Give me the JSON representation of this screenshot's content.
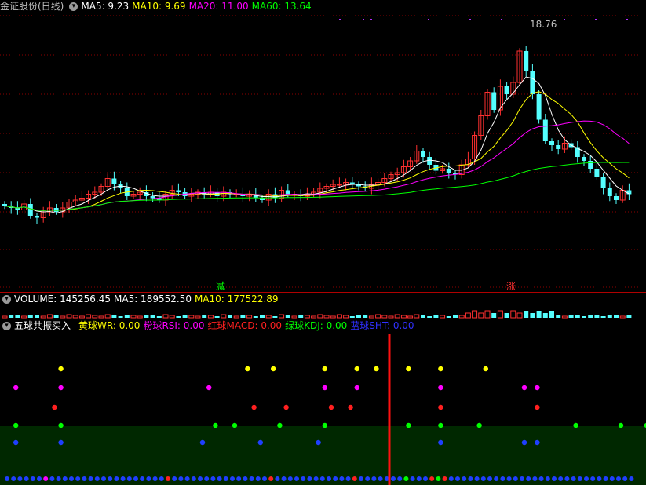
{
  "main": {
    "title": "金证股份(日线)",
    "ma": [
      {
        "label": "MA5: 9.23",
        "color": "#ffffff"
      },
      {
        "label": "MA10: 9.69",
        "color": "#ffff00"
      },
      {
        "label": "MA20: 11.00",
        "color": "#ff00ff"
      },
      {
        "label": "MA60: 13.64",
        "color": "#00ff00"
      }
    ],
    "high_label": "18.76",
    "marker_down": "减",
    "marker_up": "涨"
  },
  "volume": {
    "label": "VOLUME: 145256.45",
    "ma5": "MA5: 189552.50",
    "ma10": "MA10: 177522.89"
  },
  "indicator": {
    "title": "五球共振买入",
    "items": [
      {
        "label": "黄球WR: 0.00",
        "color": "#ffff00"
      },
      {
        "label": "粉球RSI: 0.00",
        "color": "#ff00ff"
      },
      {
        "label": "红球MACD: 0.00",
        "color": "#ff2020"
      },
      {
        "label": "绿球KDJ: 0.00",
        "color": "#00ff00"
      },
      {
        "label": "蓝球SHT: 0.00",
        "color": "#3030ff"
      }
    ]
  },
  "colors": {
    "up": "#ff3030",
    "down": "#54ffff",
    "grid": "#8b0000",
    "separator": "#b00000",
    "ma5": "#ffffff",
    "ma10": "#ffff00",
    "ma20": "#ff00ff",
    "ma60": "#00ff00"
  },
  "chart_data": {
    "type": "line",
    "title": "金证股份(日线)",
    "close": [
      9.9,
      9.8,
      9.7,
      10.0,
      9.4,
      9.3,
      9.6,
      9.8,
      9.6,
      9.8,
      10.1,
      10.2,
      10.3,
      10.5,
      10.6,
      10.9,
      11.3,
      11.0,
      10.8,
      10.4,
      10.5,
      10.6,
      10.4,
      10.3,
      10.2,
      10.5,
      10.7,
      10.6,
      10.4,
      10.5,
      10.6,
      10.5,
      10.6,
      10.4,
      10.6,
      10.5,
      10.5,
      10.4,
      10.5,
      10.3,
      10.2,
      10.5,
      10.3,
      10.7,
      10.5,
      10.5,
      10.4,
      10.5,
      10.6,
      10.8,
      10.9,
      11.0,
      11.0,
      11.1,
      11.0,
      10.9,
      10.8,
      11.0,
      11.1,
      11.3,
      11.5,
      11.6,
      11.9,
      12.2,
      12.7,
      12.4,
      12.0,
      11.7,
      11.8,
      11.6,
      11.5,
      12.0,
      12.3,
      13.5,
      14.5,
      15.7,
      14.8,
      16.0,
      15.6,
      16.2,
      17.8,
      16.8,
      15.6,
      14.3,
      13.2,
      13.0,
      12.8,
      13.1,
      12.9,
      12.4,
      12.2,
      11.8,
      11.4,
      10.8,
      10.4,
      10.2,
      10.7,
      10.5
    ]
  },
  "signals": {
    "yellow": [
      8,
      37,
      41,
      49,
      54,
      57,
      62,
      67,
      74
    ],
    "pink": [
      1,
      8,
      31,
      49,
      54,
      67,
      80,
      82
    ],
    "red": [
      7,
      38,
      43,
      50,
      53,
      67,
      82
    ],
    "green": [
      1,
      8,
      32,
      35,
      42,
      49,
      62,
      67,
      73,
      88,
      95,
      99
    ],
    "blue": [
      1,
      8,
      30,
      39,
      48,
      67,
      80,
      82
    ]
  }
}
